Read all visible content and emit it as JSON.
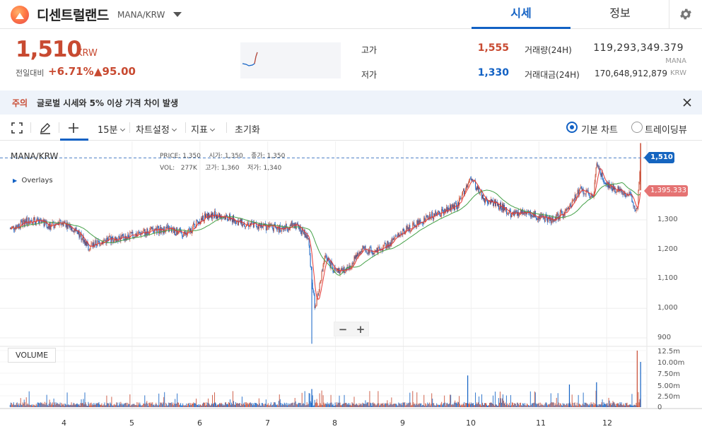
{
  "header": {
    "coin_name": "디센트럴랜드",
    "pair": "MANA/KRW",
    "tabs": [
      {
        "label": "시세",
        "active": true
      },
      {
        "label": "정보",
        "active": false
      }
    ]
  },
  "price": {
    "current": "1,510",
    "unit": "KRW",
    "change_label": "전일대비",
    "change_rate": "+6.71%",
    "change_amount": "▲95.00"
  },
  "stats": {
    "high_label": "고가",
    "high": "1,555",
    "low_label": "저가",
    "low": "1,330",
    "volume_label": "거래량(24H)",
    "volume": "119,293,349.379",
    "volume_unit": "MANA",
    "value_label": "거래대금(24H)",
    "value": "170,648,912,879",
    "value_unit": "KRW"
  },
  "notice": {
    "tag": "주의",
    "message": "글로벌 시세와 5% 이상 가격 차이 발생"
  },
  "toolbar": {
    "interval": "15분",
    "chart_settings": "차트설정",
    "indicators": "지표",
    "reset": "초기화",
    "basic_chart": "기본 차트",
    "tradingview": "트레이딩뷰"
  },
  "chart": {
    "symbol": "MANA/KRW",
    "overlays": "Overlays",
    "legend": {
      "price_label": "PRICE",
      "price": "1,350",
      "open_label": "시가",
      "open": "1,350",
      "close_label": "종가",
      "close": "1,350",
      "vol_label": "VOL",
      "vol": "277K",
      "high_label": "고가",
      "high": "1,360",
      "low_label": "저가",
      "low": "1,340"
    },
    "current_tag": "1,510",
    "ma_tag": "1,395.333",
    "volume_label": "VOLUME",
    "price_axis": [
      "1,300",
      "1,200",
      "1,100",
      "1,000",
      "900"
    ],
    "volume_axis": [
      "12.5m",
      "10.00m",
      "7.50m",
      "5.00m",
      "2.50m",
      "0"
    ],
    "date_axis": [
      "4",
      "5",
      "6",
      "7",
      "8",
      "9",
      "10",
      "11",
      "12"
    ],
    "colors": {
      "up": "#c84a31",
      "down": "#1261c4",
      "ma_short": "#e53935",
      "ma_long": "#43a047"
    }
  },
  "chart_data": {
    "type": "line",
    "title": "MANA/KRW",
    "x": [
      3.2,
      3.5,
      3.8,
      4.0,
      4.2,
      4.35,
      4.6,
      4.9,
      5.2,
      5.5,
      5.8,
      6.0,
      6.2,
      6.4,
      6.6,
      6.9,
      7.2,
      7.4,
      7.6,
      7.65,
      7.7,
      7.85,
      8.0,
      8.2,
      8.4,
      8.6,
      8.8,
      9.0,
      9.2,
      9.4,
      9.6,
      9.8,
      9.9,
      10.0,
      10.2,
      10.4,
      10.6,
      10.8,
      11.0,
      11.2,
      11.4,
      11.6,
      11.8,
      11.85,
      12.0,
      12.2,
      12.35,
      12.45,
      12.5
    ],
    "series": [
      {
        "name": "MANA/KRW",
        "values": [
          1270,
          1300,
          1280,
          1290,
          1260,
          1210,
          1230,
          1240,
          1260,
          1270,
          1250,
          1300,
          1320,
          1310,
          1290,
          1280,
          1270,
          1285,
          1240,
          1100,
          1000,
          1180,
          1120,
          1140,
          1200,
          1190,
          1220,
          1260,
          1290,
          1310,
          1330,
          1350,
          1400,
          1440,
          1370,
          1350,
          1320,
          1330,
          1310,
          1300,
          1330,
          1400,
          1380,
          1480,
          1420,
          1400,
          1380,
          1330,
          1510
        ]
      }
    ],
    "xlabel": "",
    "ylabel": "",
    "ylim": [
      900,
      1560
    ],
    "grid": true
  }
}
